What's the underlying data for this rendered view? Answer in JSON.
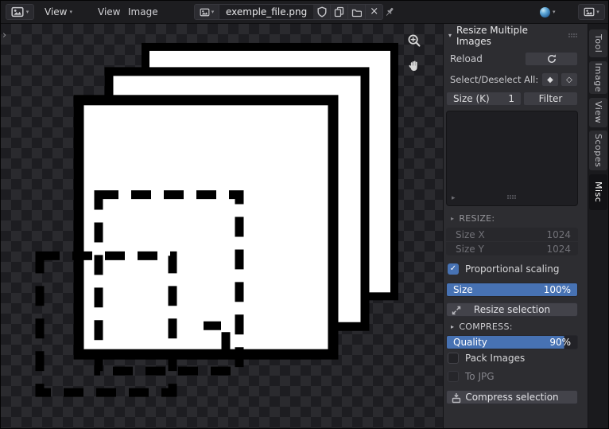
{
  "topbar": {
    "mode_label": "View",
    "menu_view": "View",
    "menu_image": "Image",
    "image_name": "exemple_file.png"
  },
  "panel": {
    "title": "Resize Multiple Images",
    "reload_label": "Reload",
    "select_deselect_label": "Select/Deselect All:",
    "size_k_label": "Size (K)",
    "size_k_value": "1",
    "filter_label": "Filter",
    "resize_header": "RESIZE:",
    "size_x_label": "Size X",
    "size_x_value": "1024",
    "size_y_label": "Size Y",
    "size_y_value": "1024",
    "proportional_label": "Proportional scaling",
    "size_label": "Size",
    "size_value": "100%",
    "size_percent": 100,
    "resize_button": "Resize selection",
    "compress_header": "COMPRESS:",
    "quality_label": "Quality",
    "quality_value": "90%",
    "quality_percent": 90,
    "pack_label": "Pack Images",
    "jpg_label": "To JPG",
    "compress_button": "Compress selection"
  },
  "tabs": [
    {
      "label": "Tool"
    },
    {
      "label": "Image"
    },
    {
      "label": "View"
    },
    {
      "label": "Scopes"
    },
    {
      "label": "Misc",
      "active": true
    }
  ],
  "glyphs": {
    "chevron_down": "▾",
    "triangle_right": "▸",
    "diamond_filled": "◆",
    "diamond_outline": "◇",
    "close": "×",
    "check": "✓",
    "collapse_arrow": "›"
  },
  "colors": {
    "accent": "#4772b3"
  }
}
